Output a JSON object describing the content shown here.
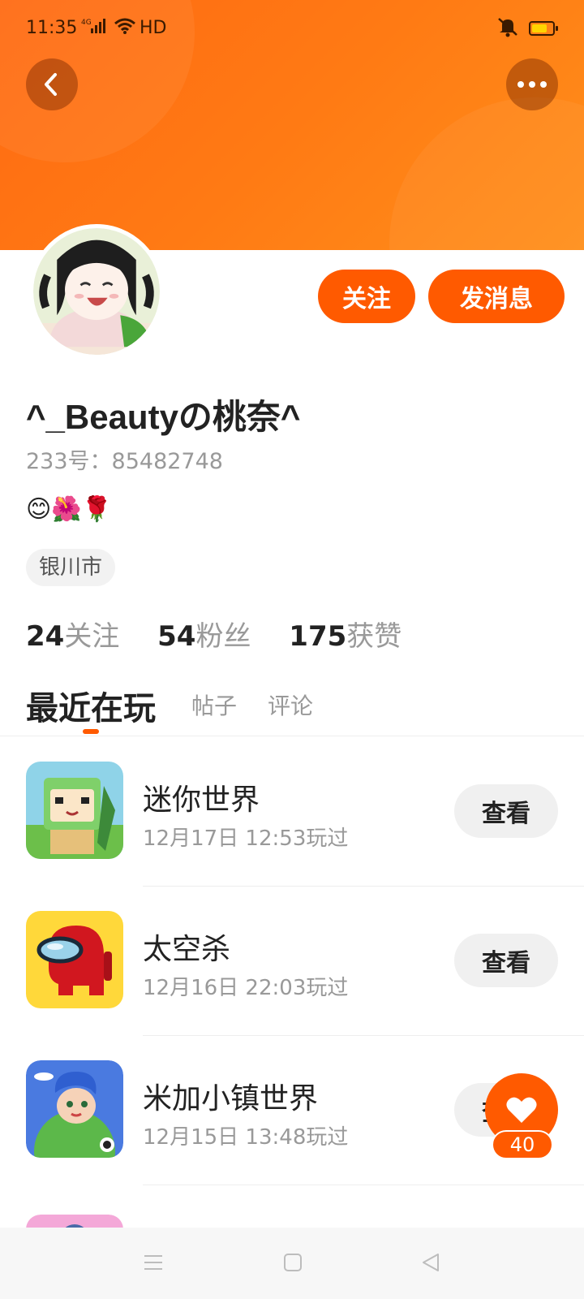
{
  "status_bar": {
    "time": "11:35",
    "signal": "4G",
    "hd": "HD"
  },
  "header": {
    "back_icon": "chevron-left-icon",
    "more_icon": "more-horizontal-icon",
    "gradient_start": "#ff6a12",
    "gradient_end": "#ff8f1a"
  },
  "profile": {
    "name": "^_Beautyの桃奈^",
    "uid_label": "233号：85482748",
    "bio": "😊🌺🌹",
    "location": "银川市",
    "follow_label": "关注",
    "message_label": "发消息",
    "stats": [
      {
        "num": "24",
        "label": "关注"
      },
      {
        "num": "54",
        "label": "粉丝"
      },
      {
        "num": "175",
        "label": "获赞"
      }
    ]
  },
  "tabs": {
    "recent": "最近在玩",
    "posts": "帖子",
    "comments": "评论"
  },
  "games": [
    {
      "name": "迷你世界",
      "time": "12月17日 12:53玩过",
      "action": "查看"
    },
    {
      "name": "太空杀",
      "time": "12月16日 22:03玩过",
      "action": "查看"
    },
    {
      "name": "米加小镇世界",
      "time": "12月15日 13:48玩过",
      "action": "查看"
    }
  ],
  "like": {
    "count": "40",
    "icon": "heart-icon"
  },
  "accent_color": "#ff5a00"
}
